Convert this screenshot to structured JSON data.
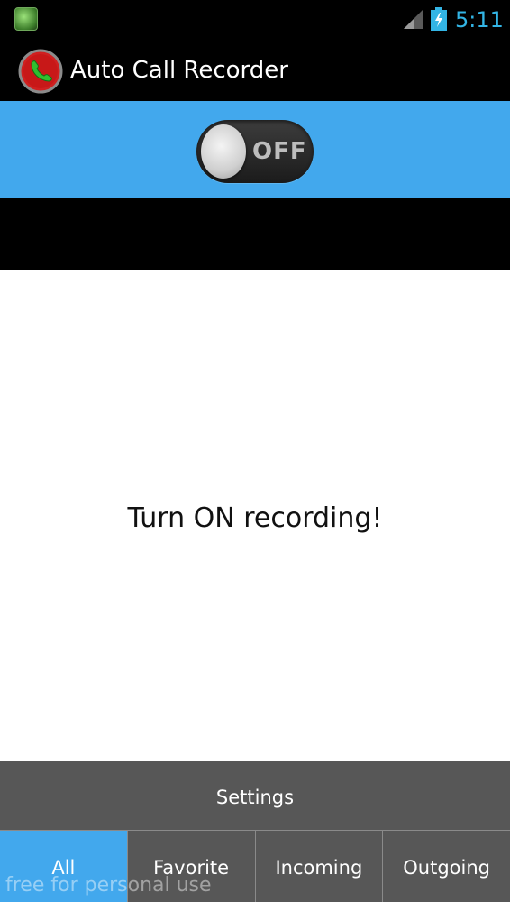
{
  "status_bar": {
    "time": "5:11",
    "notification_icon": "app-notification-icon",
    "signal_icon": "cell-signal-icon",
    "battery_icon": "battery-charging-icon",
    "accent_color": "#33b5e5"
  },
  "action_bar": {
    "app_icon": "phone-record-icon",
    "title": "Auto Call Recorder"
  },
  "toggle": {
    "label": "OFF",
    "state": "off",
    "band_color": "#42a8ed"
  },
  "main": {
    "message": "Turn ON recording!"
  },
  "settings": {
    "label": "Settings"
  },
  "tabs": [
    {
      "label": "All",
      "selected": true
    },
    {
      "label": "Favorite",
      "selected": false
    },
    {
      "label": "Incoming",
      "selected": false
    },
    {
      "label": "Outgoing",
      "selected": false
    }
  ],
  "watermark": {
    "text": "free for personal use"
  },
  "colors": {
    "accent": "#42a8ed",
    "bar_gray": "#575757"
  }
}
